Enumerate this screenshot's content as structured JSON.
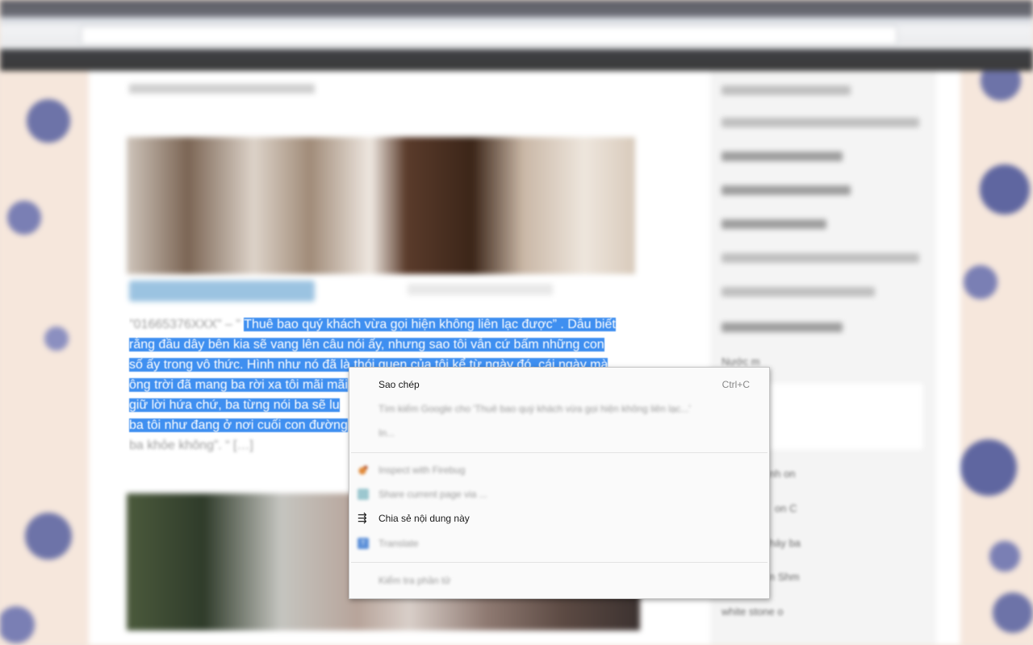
{
  "post": {
    "text_lines": [
      {
        "pre": "\"01665376XXX\" – \" ",
        "sel": "Thuê bao quý khách vừa gọi hiện không liên lạc được” . Dẫu biết"
      },
      {
        "pre": "",
        "sel": "rằng đầu dây bên kia sẽ vang lên câu nói ấy, nhưng sao tôi vẫn cứ bấm những con"
      },
      {
        "pre": "",
        "sel": "số ấy trong vô thức. Hình như nó đã là thói quen của tôi kể từ ngày đó, cái ngày mà"
      },
      {
        "pre": "",
        "sel": "ông trời đã mang ba rời xa tôi mãi mãi"
      },
      {
        "pre": "",
        "sel": "giữ lời hứa chứ, ba từng nói ba sẽ lu"
      },
      {
        "pre": "",
        "sel": "ba tôi như đang ở nơi cuối con đường"
      },
      {
        "pre": "ba khỏe không”. “ […]",
        "sel": ""
      }
    ]
  },
  "sidebar": {
    "visible_texts": [
      "Nước m",
      "nh on",
      "on C",
      "háy ba",
      "n Shm",
      "white stone o"
    ]
  },
  "context_menu": {
    "items": {
      "copy": {
        "label": "Sao chép",
        "shortcut": "Ctrl+C"
      },
      "search": {
        "label": "Tìm kiếm Google cho 'Thuê bao quý khách vừa gọi hiện không liên lạc...'"
      },
      "print": {
        "label": "In..."
      },
      "firebug": {
        "label": "Inspect with Firebug",
        "icon": "firebug-icon"
      },
      "share_page": {
        "label": "Share current page via ...",
        "icon": "app-icon"
      },
      "share_content": {
        "label": "Chia sẻ nội dung này",
        "icon": "share-icon"
      },
      "translate": {
        "label": "Translate",
        "icon": "translate-icon"
      },
      "inspect": {
        "label": "Kiểm tra phần tử"
      }
    }
  }
}
